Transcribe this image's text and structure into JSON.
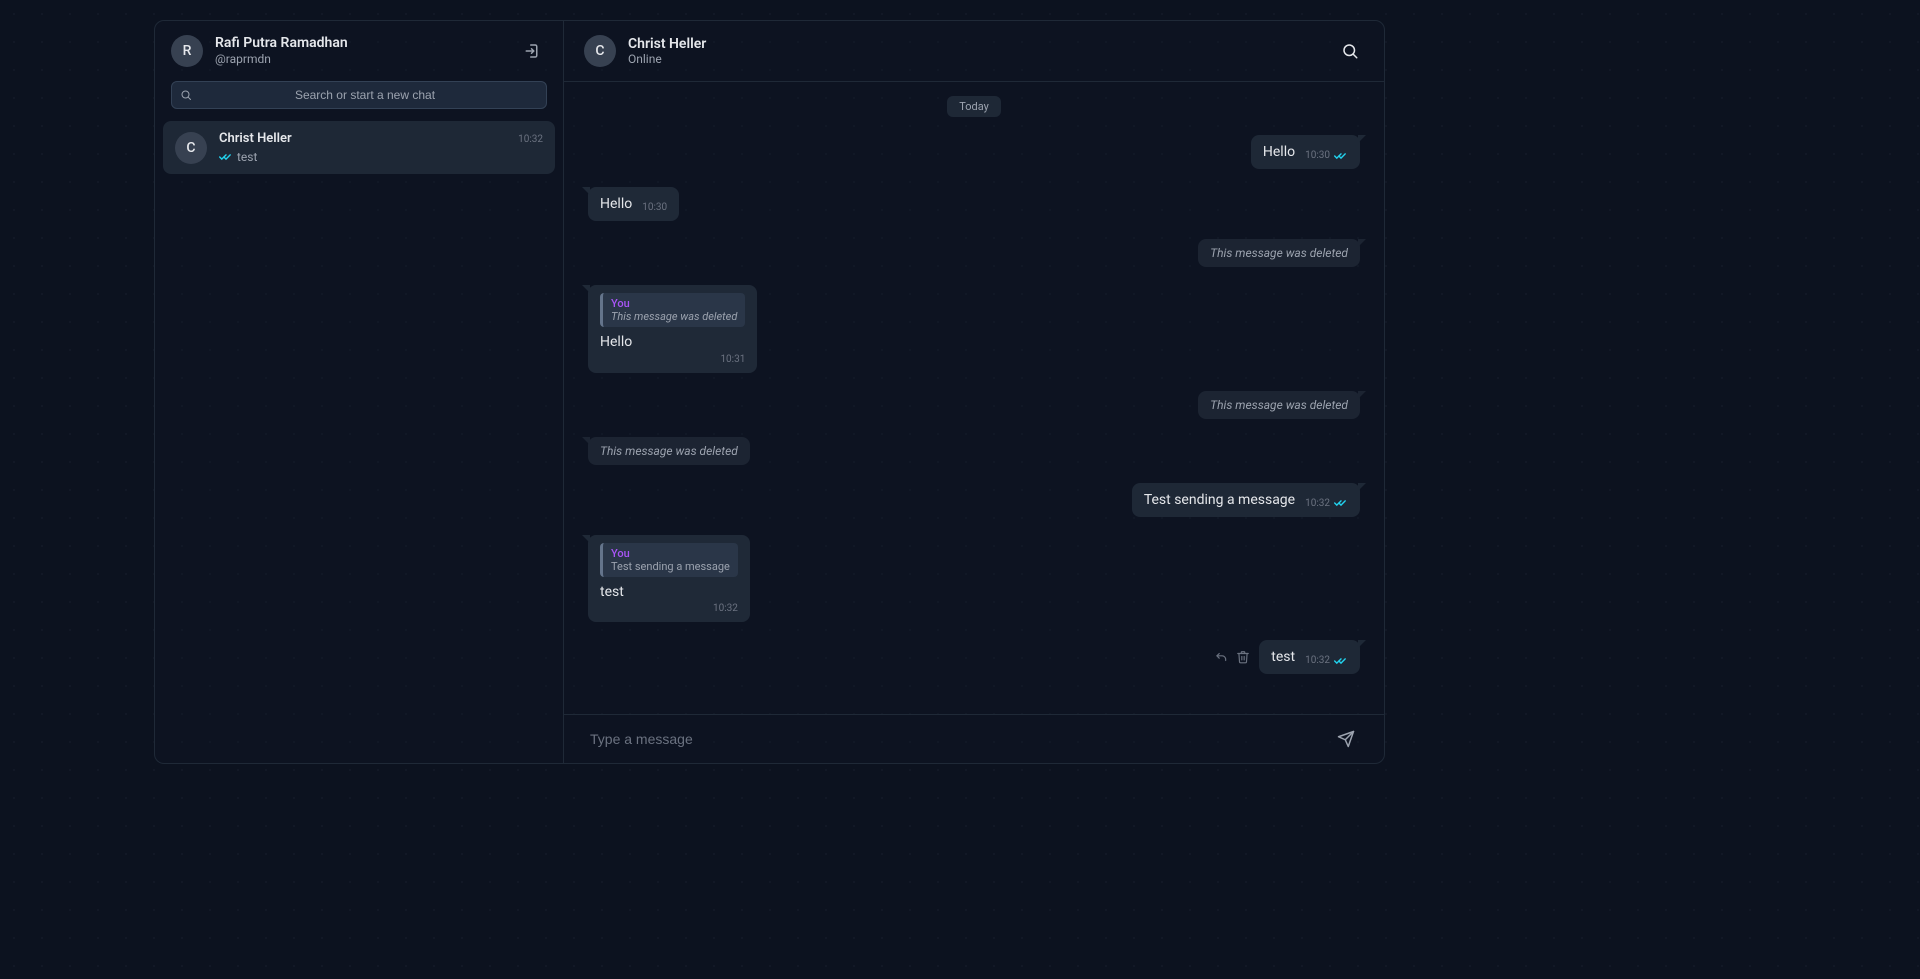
{
  "sidebar": {
    "user": {
      "avatar_letter": "R",
      "name": "Rafi Putra Ramadhan",
      "handle": "@raprmdn"
    },
    "search_placeholder": "Search or start a new chat",
    "chats": [
      {
        "avatar_letter": "C",
        "name": "Christ Heller",
        "time": "10:32",
        "preview": "test"
      }
    ]
  },
  "chat": {
    "contact": {
      "avatar_letter": "C",
      "name": "Christ Heller",
      "status": "Online"
    },
    "date_label": "Today",
    "deleted_text": "This message was deleted",
    "reply_you_label": "You",
    "messages": [
      {
        "id": 0,
        "side": "out",
        "type": "text",
        "text": "Hello",
        "time": "10:30"
      },
      {
        "id": 1,
        "side": "in",
        "type": "text",
        "text": "Hello",
        "time": "10:30"
      },
      {
        "id": 2,
        "side": "out",
        "type": "deleted"
      },
      {
        "id": 3,
        "side": "in",
        "type": "reply",
        "reply_title": "You",
        "reply_body": "This message was deleted",
        "reply_italic": true,
        "text": "Hello",
        "time": "10:31"
      },
      {
        "id": 4,
        "side": "out",
        "type": "deleted"
      },
      {
        "id": 5,
        "side": "in",
        "type": "deleted"
      },
      {
        "id": 6,
        "side": "out",
        "type": "text",
        "text": "Test sending a message",
        "time": "10:32"
      },
      {
        "id": 7,
        "side": "in",
        "type": "reply",
        "reply_title": "You",
        "reply_body": "Test sending a message",
        "reply_italic": false,
        "text": "test",
        "time": "10:32"
      },
      {
        "id": 8,
        "side": "out",
        "type": "text",
        "text": "test",
        "time": "10:32",
        "show_actions": true
      }
    ],
    "composer_placeholder": "Type a message"
  }
}
